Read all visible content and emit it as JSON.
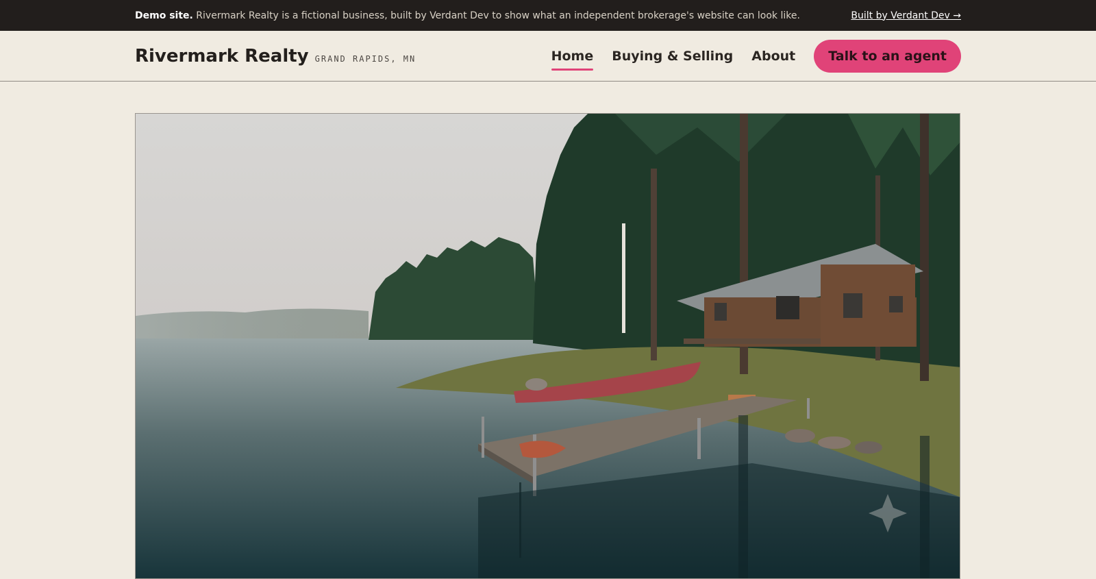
{
  "demo_bar": {
    "label": "Demo site.",
    "text": "Rivermark Realty is a fictional business, built by Verdant Dev to show what an independent brokerage's website can look like.",
    "link": "Built by Verdant Dev →"
  },
  "header": {
    "brand": "Rivermark Realty",
    "location": "GRAND RAPIDS, MN",
    "nav": [
      {
        "label": "Home",
        "active": true
      },
      {
        "label": "Buying & Selling",
        "active": false
      },
      {
        "label": "About",
        "active": false
      }
    ],
    "cta": "Talk to an agent"
  },
  "hero": {
    "image": "lakeside-cabin-photo",
    "colors": {
      "accent": "#e04378",
      "topbar": "#221e1c",
      "page": "#f0ebe1"
    }
  }
}
